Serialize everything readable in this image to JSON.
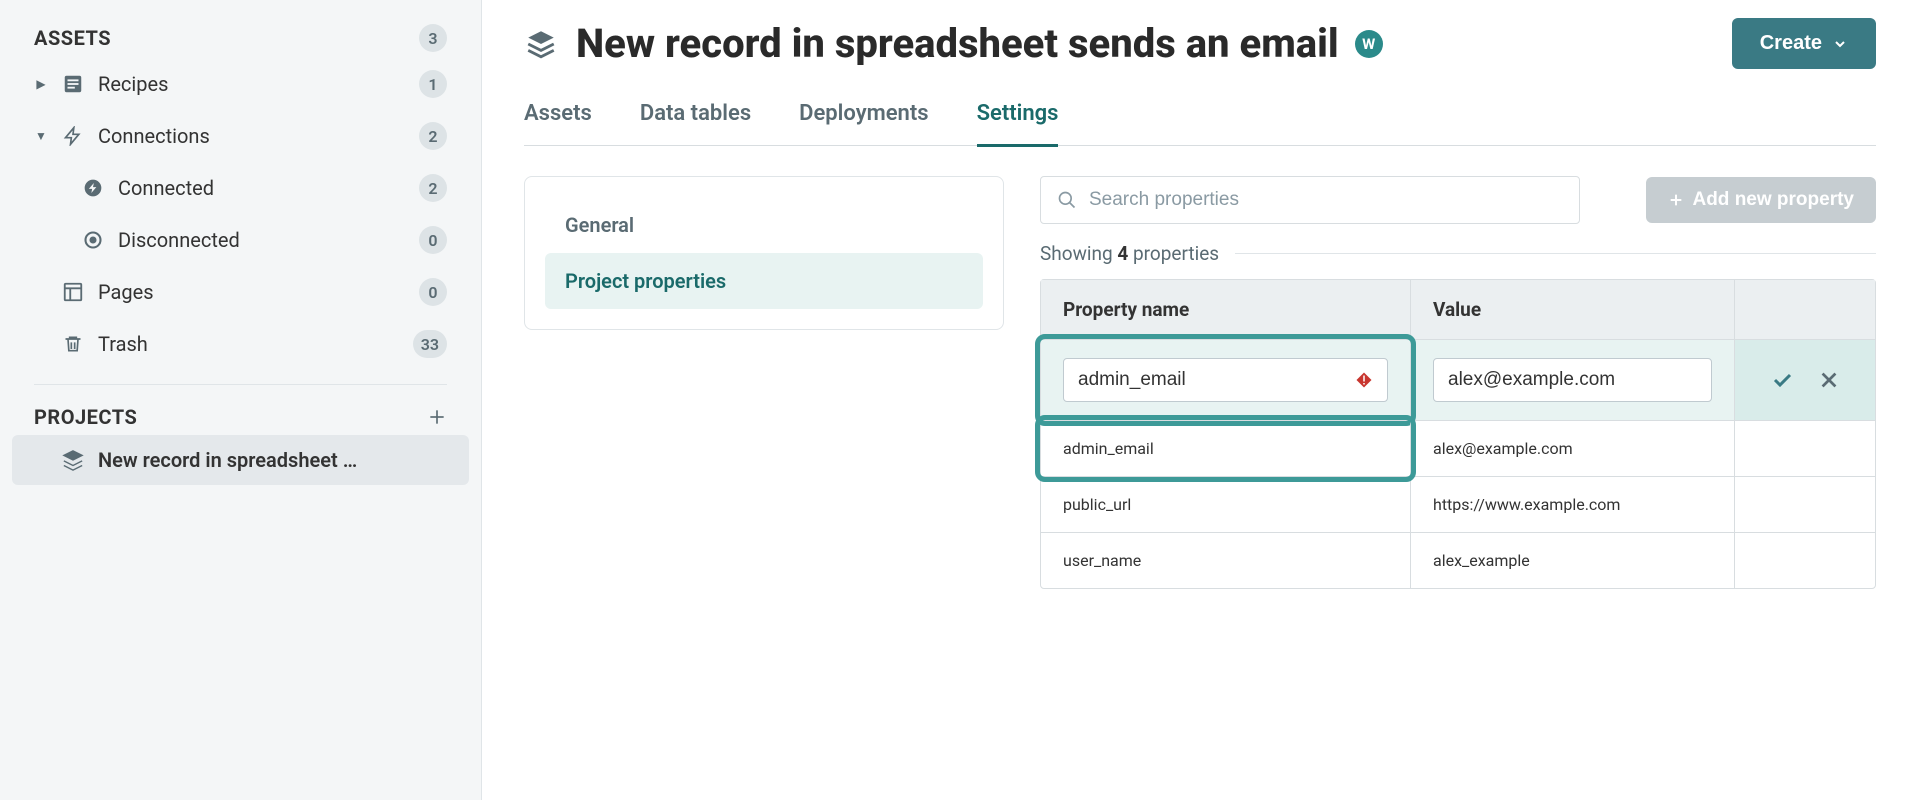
{
  "sidebar": {
    "assets": {
      "title": "ASSETS",
      "count": "3",
      "items": [
        {
          "label": "Recipes",
          "count": "1"
        },
        {
          "label": "Connections",
          "count": "2"
        },
        {
          "label": "Connected",
          "count": "2"
        },
        {
          "label": "Disconnected",
          "count": "0"
        },
        {
          "label": "Pages",
          "count": "0"
        },
        {
          "label": "Trash",
          "count": "33"
        }
      ]
    },
    "projects": {
      "title": "PROJECTS",
      "items": [
        {
          "label": "New record in spreadsheet …"
        }
      ]
    }
  },
  "header": {
    "title": "New record in spreadsheet sends an email",
    "badge": "W",
    "create_label": "Create"
  },
  "tabs": [
    {
      "label": "Assets"
    },
    {
      "label": "Data tables"
    },
    {
      "label": "Deployments"
    },
    {
      "label": "Settings"
    }
  ],
  "settings_nav": [
    {
      "label": "General"
    },
    {
      "label": "Project properties"
    }
  ],
  "props": {
    "search_placeholder": "Search properties",
    "add_button": "Add new property",
    "showing_prefix": "Showing ",
    "showing_count": "4",
    "showing_suffix": " properties",
    "columns": {
      "name": "Property name",
      "value": "Value"
    },
    "rows": [
      {
        "name": "admin_email",
        "value": "alex@example.com",
        "editing": true,
        "warn": true
      },
      {
        "name": "admin_email",
        "value": "alex@example.com",
        "editing": false
      },
      {
        "name": "public_url",
        "value": "https://www.example.com",
        "editing": false
      },
      {
        "name": "user_name",
        "value": "alex_example",
        "editing": false
      }
    ]
  }
}
